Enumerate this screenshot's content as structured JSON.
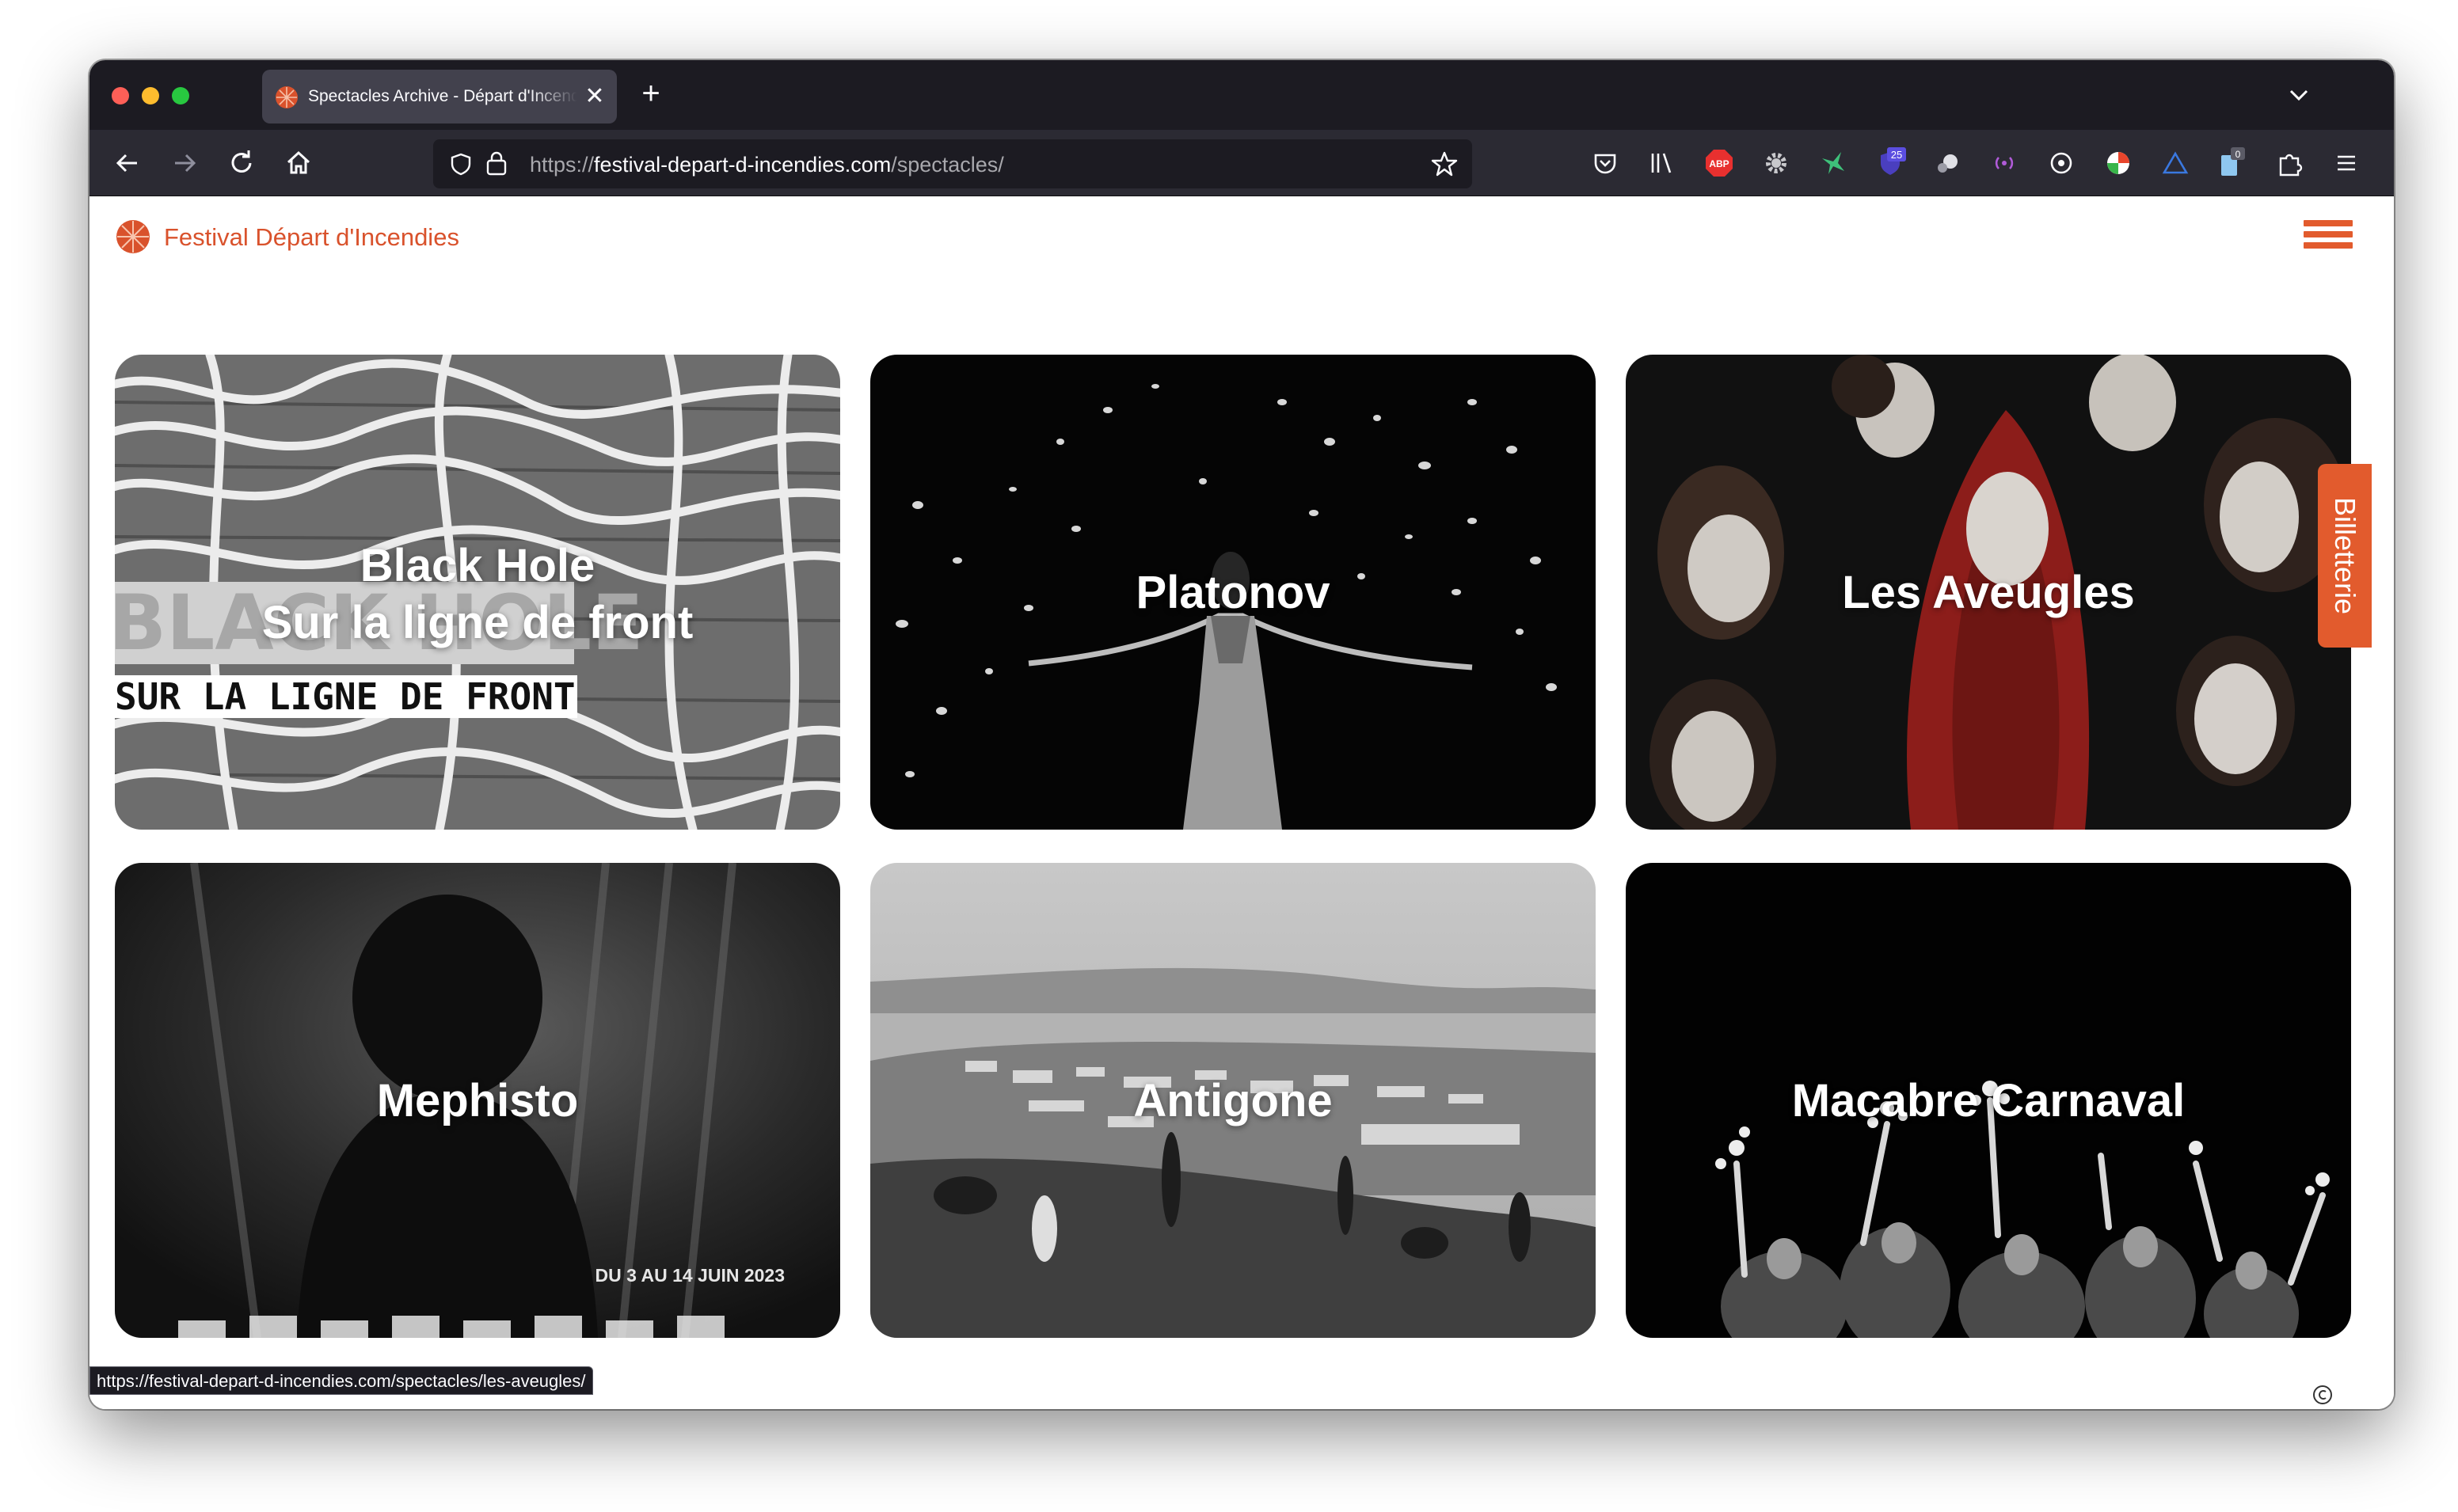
{
  "browser": {
    "tab_title": "Spectacles Archive - Départ d'Incendies",
    "tab_close": "✕",
    "new_tab": "+",
    "url_prefix": "https://",
    "url_host": "festival-depart-d-incendies.com",
    "url_path": "/spectacles/",
    "extension_badges": {
      "ublock_count": "25",
      "extra_count": "0"
    },
    "adblock_label": "ABP"
  },
  "site": {
    "title": "Festival Départ d'Incendies",
    "accent_color": "#e25b2d",
    "billetterie_label": "Billetterie"
  },
  "cards": [
    {
      "title_line1": "Black Hole",
      "title_line2": "Sur la ligne de front",
      "poster_line1": "BLACK HOLE",
      "poster_line2": "SUR LA LIGNE DE FRONT"
    },
    {
      "title": "Platonov"
    },
    {
      "title": "Les Aveugles"
    },
    {
      "title": "Mephisto",
      "date_text": "DU 3 AU 14 JUIN 2023"
    },
    {
      "title": "Antigone"
    },
    {
      "title": "Macabre Carnaval"
    }
  ],
  "status_bar": {
    "hover_url": "https://festival-depart-d-incendies.com/spectacles/les-aveugles/"
  }
}
